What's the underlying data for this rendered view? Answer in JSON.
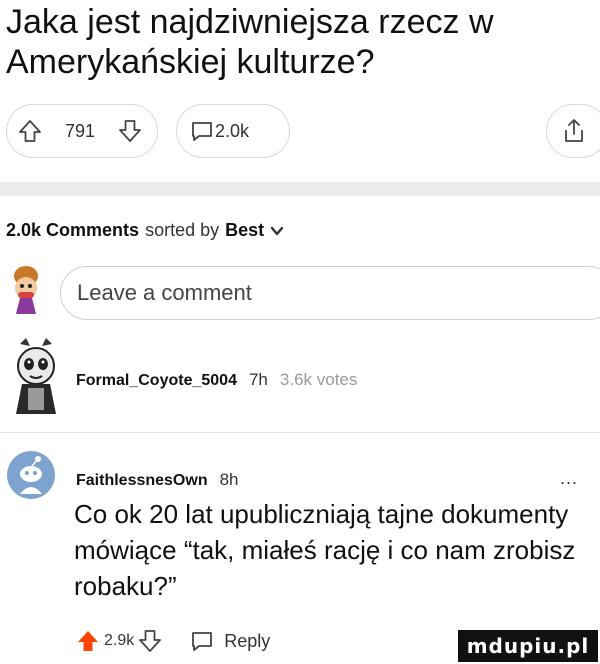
{
  "post": {
    "title": "Jaka jest najdziwniejsza rzecz w Amerykańskiej kulturze?",
    "upvotes": "791",
    "comments": "2.0k"
  },
  "comments_section": {
    "count": "2.0k Comments",
    "sorted_by": "sorted by",
    "sort_value": "Best",
    "input_placeholder": "Leave a comment"
  },
  "comments": [
    {
      "username": "Formal_Coyote_5004",
      "time": "7h",
      "votes": "3.6k votes"
    },
    {
      "username": "FaithlessnesOwn",
      "time": "8h",
      "more": "...",
      "body": "Co ok 20 lat upubliczniają tajne dokumenty mówiące “tak, miałeś rację i co nam zrobisz robaku?”",
      "upvotes": "2.9k",
      "reply_label": "Reply"
    }
  ],
  "watermark": "mdupiu.pl",
  "colors": {
    "accent_orange": "#ff4500",
    "divider_band": "#ebebeb",
    "muted_text": "#9a9a9a"
  }
}
